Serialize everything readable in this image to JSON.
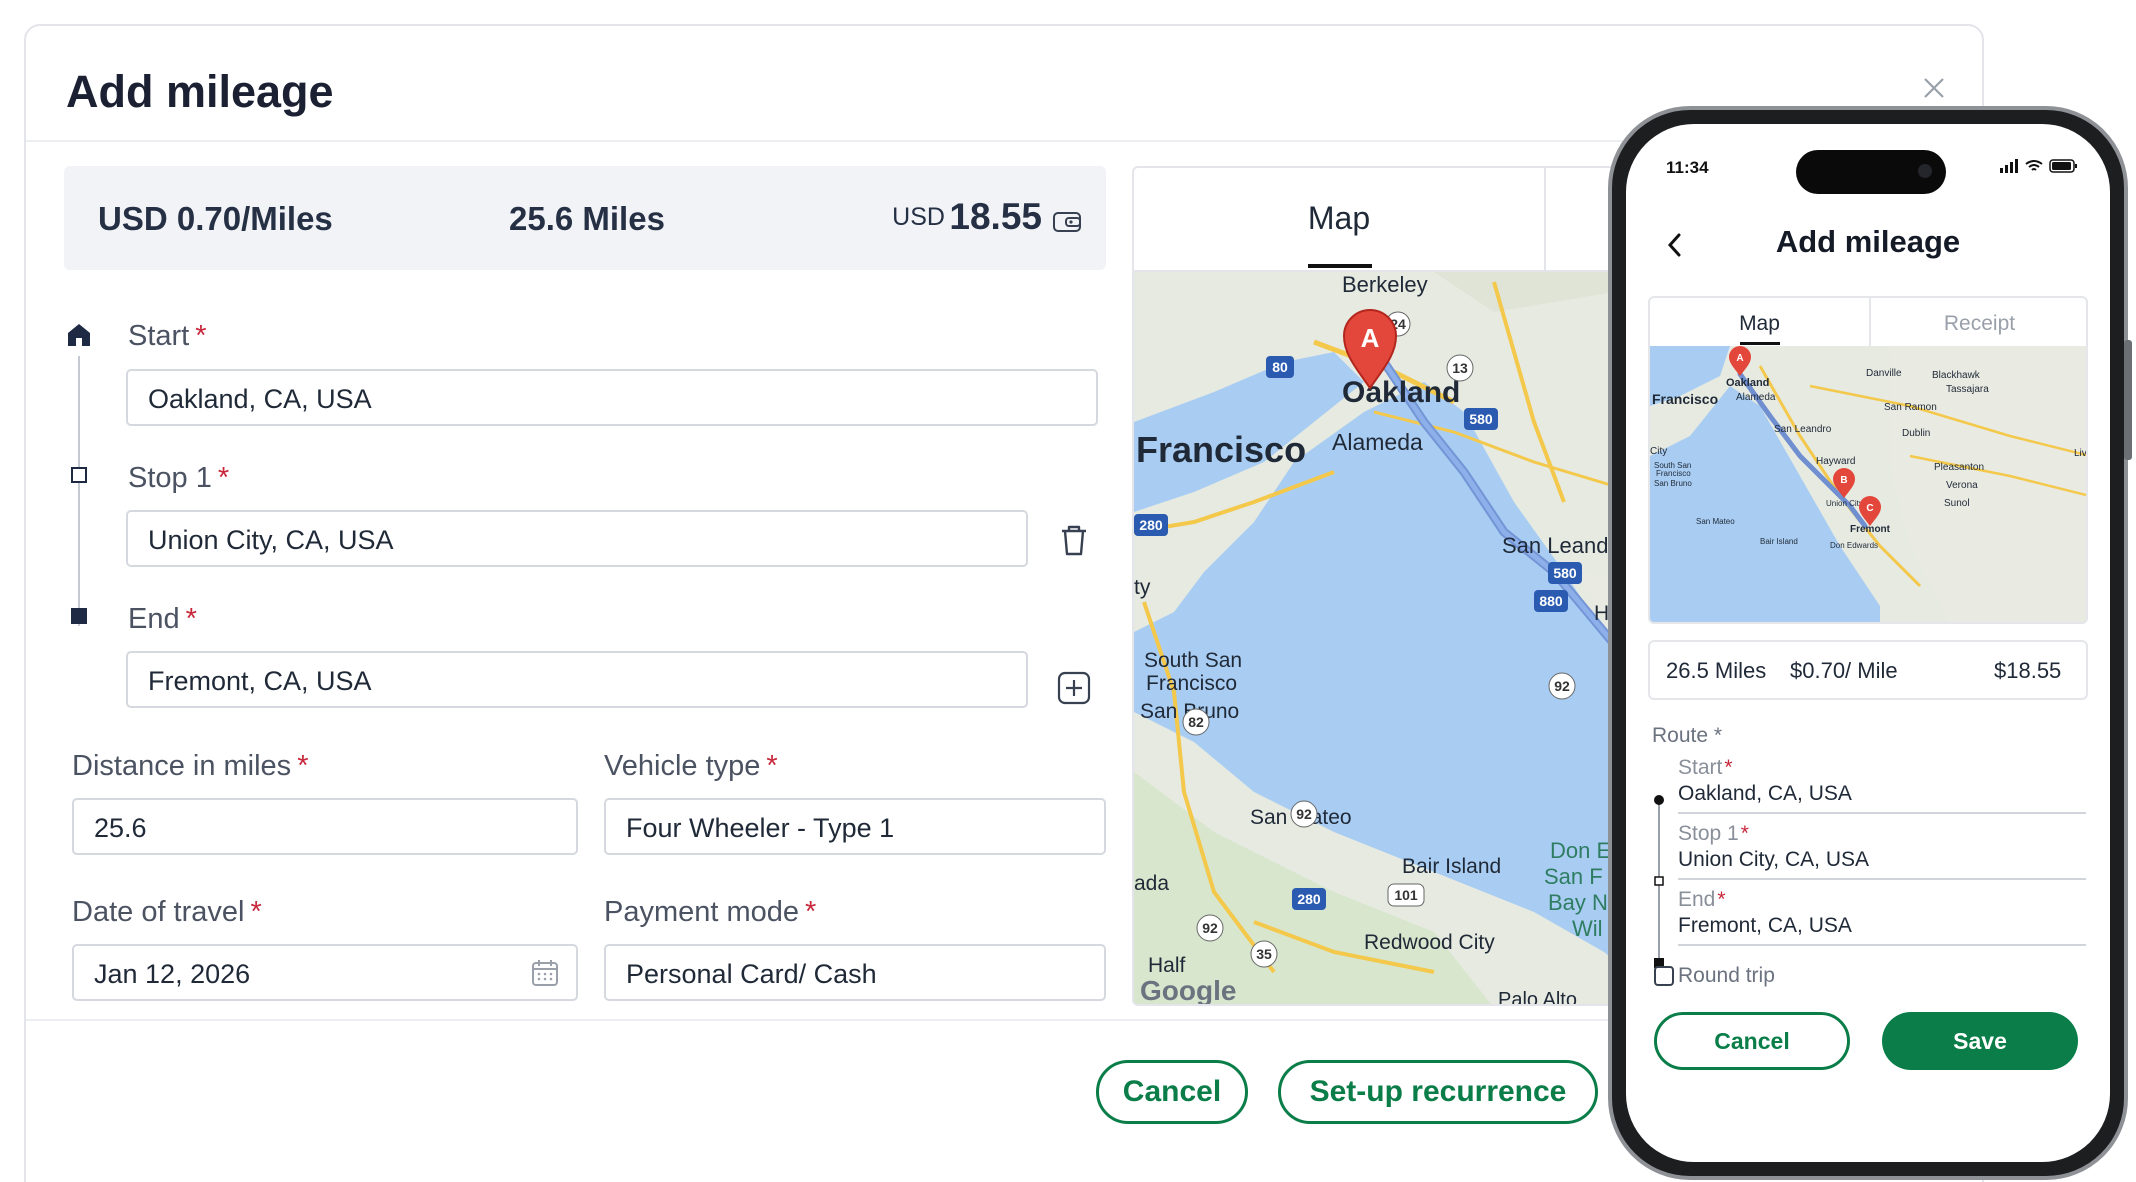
{
  "modal": {
    "title": "Add mileage",
    "summary": {
      "rate": "USD 0.70/Miles",
      "miles": "25.6 Miles",
      "currency": "USD",
      "amount": "18.55"
    },
    "route": {
      "start": {
        "label": "Start",
        "value": "Oakland, CA, USA"
      },
      "stop1": {
        "label": "Stop 1",
        "value": "Union City, CA, USA"
      },
      "end": {
        "label": "End",
        "value": "Fremont, CA, USA"
      }
    },
    "required_mark": "*",
    "distance": {
      "label": "Distance in miles",
      "value": "25.6"
    },
    "vehicle": {
      "label": "Vehicle type",
      "value": "Four Wheeler - Type 1"
    },
    "date": {
      "label": "Date of travel",
      "value": "Jan 12, 2026"
    },
    "payment": {
      "label": "Payment mode",
      "value": "Personal Card/ Cash"
    },
    "map": {
      "tab_label": "Map",
      "places": [
        "Berkeley",
        "Oakland",
        "Alameda",
        "Francisco",
        "San Leandro",
        "South San",
        "Francisco",
        "San Bruno",
        "San Mateo",
        "Bair Island",
        "Redwood City",
        "Half",
        "ada",
        "ty",
        "Hay",
        "Don E",
        "San F",
        "Bay N",
        "Wil",
        "Palo Alto"
      ],
      "highways": [
        "80",
        "24",
        "13",
        "580",
        "280",
        "580",
        "880",
        "92",
        "82",
        "92",
        "101",
        "280",
        "92",
        "35"
      ],
      "marker": "A",
      "google": "Google"
    },
    "buttons": {
      "cancel": "Cancel",
      "recurrence": "Set-up recurrence"
    }
  },
  "phone": {
    "time": "11:34",
    "title": "Add mileage",
    "tabs": [
      "Map",
      "Receipt"
    ],
    "map": {
      "places": [
        "Oakland",
        "Francisco",
        "Alameda",
        "Danville",
        "Blackhawk",
        "Tassajara",
        "San Ramon",
        "San Leandro",
        "Dublin",
        "City",
        "Hayward",
        "Pleasanton",
        "Live",
        "South San",
        "Francisco",
        "San Bruno",
        "Verona",
        "Union City",
        "Sunol",
        "San Mateo",
        "Fremont",
        "Bair Island",
        "Don Edwards"
      ],
      "markers": [
        "A",
        "B",
        "C"
      ]
    },
    "summary": {
      "miles": "26.5 Miles",
      "rate": "$0.70/ Mile",
      "amount": "$18.55"
    },
    "route_label": "Route *",
    "route": {
      "start": {
        "label": "Start",
        "value": "Oakland, CA, USA"
      },
      "stop1": {
        "label": "Stop 1",
        "value": "Union City, CA, USA"
      },
      "end": {
        "label": "End",
        "value": "Fremont, CA, USA"
      }
    },
    "round_trip": "Round trip",
    "buttons": {
      "cancel": "Cancel",
      "save": "Save"
    }
  }
}
